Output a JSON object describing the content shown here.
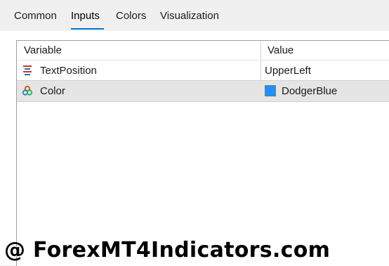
{
  "tabs": [
    {
      "label": "Common"
    },
    {
      "label": "Inputs",
      "active": true
    },
    {
      "label": "Colors"
    },
    {
      "label": "Visualization"
    }
  ],
  "grid": {
    "headers": {
      "variable": "Variable",
      "value": "Value"
    },
    "rows": [
      {
        "name": "TextPosition",
        "value": "UpperLeft",
        "icon": "enum-icon"
      },
      {
        "name": "Color",
        "value": "DodgerBlue",
        "icon": "color-icon",
        "swatch_color": "#1e90ff"
      }
    ]
  },
  "watermark": "@ ForexMT4Indicators.com"
}
